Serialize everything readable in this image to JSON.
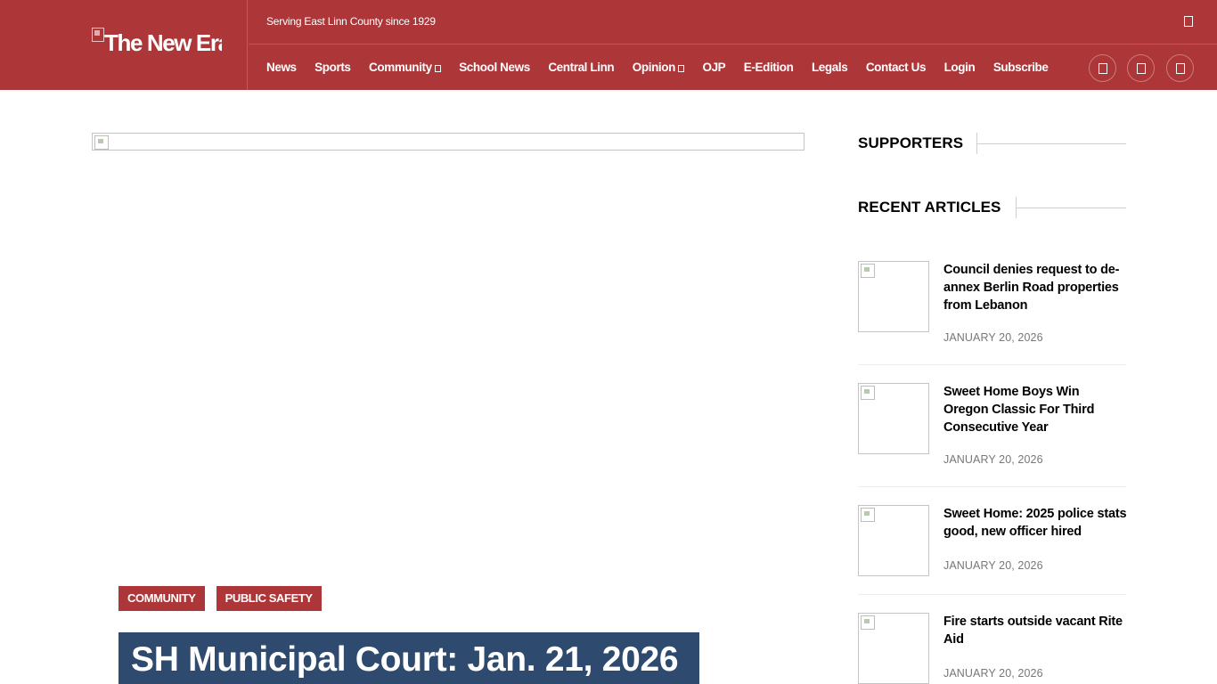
{
  "header": {
    "logo_text": "The New Era",
    "tagline": "Serving East Linn County since 1929",
    "nav": [
      {
        "label": "News",
        "dropdown": false
      },
      {
        "label": "Sports",
        "dropdown": false
      },
      {
        "label": "Community",
        "dropdown": true
      },
      {
        "label": "School News",
        "dropdown": false
      },
      {
        "label": "Central Linn",
        "dropdown": false
      },
      {
        "label": "Opinion",
        "dropdown": true
      },
      {
        "label": "OJP",
        "dropdown": false
      },
      {
        "label": "E-Edition",
        "dropdown": false
      },
      {
        "label": "Legals",
        "dropdown": false
      },
      {
        "label": "Contact Us",
        "dropdown": false
      },
      {
        "label": "Login",
        "dropdown": false
      },
      {
        "label": "Subscribe",
        "dropdown": false
      }
    ],
    "social_icons": [
      "social-icon-1",
      "social-icon-2",
      "social-icon-3"
    ],
    "top_icon": "search-icon"
  },
  "article": {
    "categories": [
      "COMMUNITY",
      "PUBLIC SAFETY"
    ],
    "title": "SH Municipal Court: Jan. 21, 2026"
  },
  "sidebar": {
    "supporters_title": "SUPPORTERS",
    "recent_title": "RECENT ARTICLES",
    "recent": [
      {
        "title": "Council denies request to de-annex Berlin Road properties from Lebanon",
        "date": "JANUARY 20, 2026"
      },
      {
        "title": "Sweet Home Boys Win Oregon Classic For Third Consecutive Year",
        "date": "JANUARY 20, 2026"
      },
      {
        "title": "Sweet Home: 2025 police stats good, new officer hired",
        "date": "JANUARY 20, 2026"
      },
      {
        "title": "Fire starts outside vacant Rite Aid",
        "date": "JANUARY 20, 2026"
      }
    ]
  },
  "colors": {
    "brand_red": "#ad3639",
    "title_navy": "#2e4a6e",
    "date_gray": "#777777"
  }
}
